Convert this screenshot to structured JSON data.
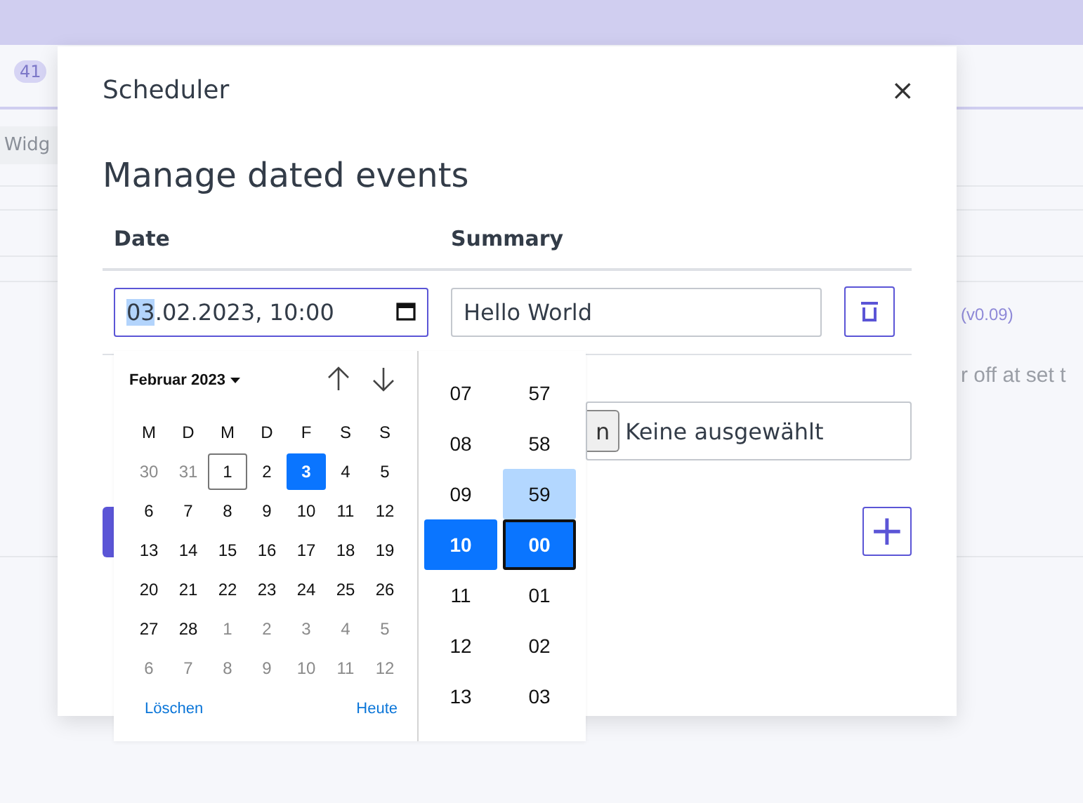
{
  "background": {
    "badge": "41",
    "chip": "Widg",
    "version": "(v0.09)",
    "description": "r off at set t"
  },
  "dialog": {
    "title": "Scheduler",
    "close": "×",
    "heading": "Manage dated events",
    "columns": [
      "Date",
      "Summary"
    ],
    "event": {
      "date_segments": [
        {
          "text": "03",
          "selected": true
        },
        {
          "text": ".02.2023, 10:00",
          "selected": false
        }
      ],
      "summary": "Hello World"
    },
    "upload": {
      "button": "n",
      "status": "Keine ausgewählt"
    },
    "add": "+"
  },
  "picker": {
    "month": "Februar 2023",
    "weekdays": [
      "M",
      "D",
      "M",
      "D",
      "F",
      "S",
      "S"
    ],
    "days": [
      {
        "label": "30",
        "outside_month": true,
        "selected": false,
        "focused": false
      },
      {
        "label": "31",
        "outside_month": true,
        "selected": false,
        "focused": false
      },
      {
        "label": "1",
        "outside_month": false,
        "selected": false,
        "focused": true
      },
      {
        "label": "2",
        "outside_month": false,
        "selected": false,
        "focused": false
      },
      {
        "label": "3",
        "outside_month": false,
        "selected": true,
        "focused": false
      },
      {
        "label": "4",
        "outside_month": false,
        "selected": false,
        "focused": false
      },
      {
        "label": "5",
        "outside_month": false,
        "selected": false,
        "focused": false
      },
      {
        "label": "6",
        "outside_month": false,
        "selected": false,
        "focused": false
      },
      {
        "label": "7",
        "outside_month": false,
        "selected": false,
        "focused": false
      },
      {
        "label": "8",
        "outside_month": false,
        "selected": false,
        "focused": false
      },
      {
        "label": "9",
        "outside_month": false,
        "selected": false,
        "focused": false
      },
      {
        "label": "10",
        "outside_month": false,
        "selected": false,
        "focused": false
      },
      {
        "label": "11",
        "outside_month": false,
        "selected": false,
        "focused": false
      },
      {
        "label": "12",
        "outside_month": false,
        "selected": false,
        "focused": false
      },
      {
        "label": "13",
        "outside_month": false,
        "selected": false,
        "focused": false
      },
      {
        "label": "14",
        "outside_month": false,
        "selected": false,
        "focused": false
      },
      {
        "label": "15",
        "outside_month": false,
        "selected": false,
        "focused": false
      },
      {
        "label": "16",
        "outside_month": false,
        "selected": false,
        "focused": false
      },
      {
        "label": "17",
        "outside_month": false,
        "selected": false,
        "focused": false
      },
      {
        "label": "18",
        "outside_month": false,
        "selected": false,
        "focused": false
      },
      {
        "label": "19",
        "outside_month": false,
        "selected": false,
        "focused": false
      },
      {
        "label": "20",
        "outside_month": false,
        "selected": false,
        "focused": false
      },
      {
        "label": "21",
        "outside_month": false,
        "selected": false,
        "focused": false
      },
      {
        "label": "22",
        "outside_month": false,
        "selected": false,
        "focused": false
      },
      {
        "label": "23",
        "outside_month": false,
        "selected": false,
        "focused": false
      },
      {
        "label": "24",
        "outside_month": false,
        "selected": false,
        "focused": false
      },
      {
        "label": "25",
        "outside_month": false,
        "selected": false,
        "focused": false
      },
      {
        "label": "26",
        "outside_month": false,
        "selected": false,
        "focused": false
      },
      {
        "label": "27",
        "outside_month": false,
        "selected": false,
        "focused": false
      },
      {
        "label": "28",
        "outside_month": false,
        "selected": false,
        "focused": false
      },
      {
        "label": "1",
        "outside_month": true,
        "selected": false,
        "focused": false
      },
      {
        "label": "2",
        "outside_month": true,
        "selected": false,
        "focused": false
      },
      {
        "label": "3",
        "outside_month": true,
        "selected": false,
        "focused": false
      },
      {
        "label": "4",
        "outside_month": true,
        "selected": false,
        "focused": false
      },
      {
        "label": "5",
        "outside_month": true,
        "selected": false,
        "focused": false
      },
      {
        "label": "6",
        "outside_month": true,
        "selected": false,
        "focused": false
      },
      {
        "label": "7",
        "outside_month": true,
        "selected": false,
        "focused": false
      },
      {
        "label": "8",
        "outside_month": true,
        "selected": false,
        "focused": false
      },
      {
        "label": "9",
        "outside_month": true,
        "selected": false,
        "focused": false
      },
      {
        "label": "10",
        "outside_month": true,
        "selected": false,
        "focused": false
      },
      {
        "label": "11",
        "outside_month": true,
        "selected": false,
        "focused": false
      },
      {
        "label": "12",
        "outside_month": true,
        "selected": false,
        "focused": false
      }
    ],
    "clear": "Löschen",
    "today": "Heute",
    "hours": [
      {
        "label": "07",
        "selected": false
      },
      {
        "label": "08",
        "selected": false
      },
      {
        "label": "09",
        "selected": false
      },
      {
        "label": "10",
        "selected": true
      },
      {
        "label": "11",
        "selected": false
      },
      {
        "label": "12",
        "selected": false
      },
      {
        "label": "13",
        "selected": false
      }
    ],
    "minutes": [
      {
        "label": "57",
        "selected": false,
        "hovered": false
      },
      {
        "label": "58",
        "selected": false,
        "hovered": false
      },
      {
        "label": "59",
        "selected": false,
        "hovered": true
      },
      {
        "label": "00",
        "selected": true,
        "hovered": false
      },
      {
        "label": "01",
        "selected": false,
        "hovered": false
      },
      {
        "label": "02",
        "selected": false,
        "hovered": false
      },
      {
        "label": "03",
        "selected": false,
        "hovered": false
      }
    ]
  }
}
